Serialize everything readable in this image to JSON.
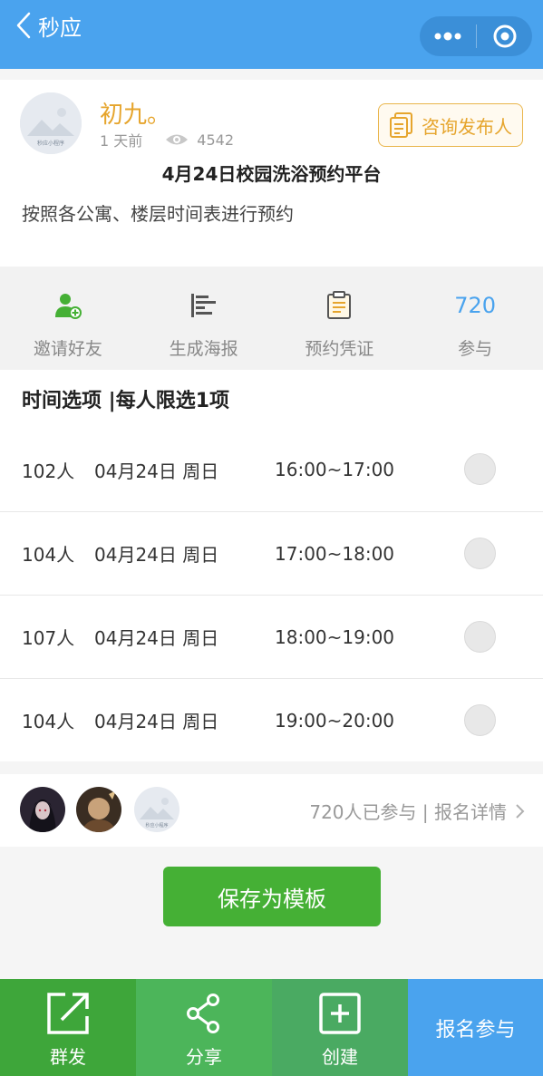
{
  "topbar": {
    "title": "秒应",
    "menu_icon": "more-dots-icon",
    "close_icon": "target-circle-icon"
  },
  "header": {
    "author": "初九。",
    "time_ago": "1 天前",
    "views": "4542",
    "consult_label": "咨询发布人",
    "avatar_watermark": "秒应小程序",
    "title": "4月24日校园洗浴预约平台",
    "description": "按照各公寓、楼层时间表进行预约"
  },
  "actions": [
    {
      "label": "邀请好友",
      "icon": "invite-friend-icon"
    },
    {
      "label": "生成海报",
      "icon": "poster-icon"
    },
    {
      "label": "预约凭证",
      "icon": "voucher-icon"
    },
    {
      "label": "参与",
      "value": "720"
    }
  ],
  "section": {
    "title": "时间选项 |每人限选1项"
  },
  "options": [
    {
      "count": "102人",
      "date": "04月24日 周日",
      "time": "16:00~17:00"
    },
    {
      "count": "104人",
      "date": "04月24日 周日",
      "time": "17:00~18:00"
    },
    {
      "count": "107人",
      "date": "04月24日 周日",
      "time": "18:00~19:00"
    },
    {
      "count": "104人",
      "date": "04月24日 周日",
      "time": "19:00~20:00"
    }
  ],
  "participants": {
    "summary": "720人已参与 | 报名详情",
    "avatar_watermark": "秒应小程序"
  },
  "save_button": "保存为模板",
  "bottom_bar": [
    {
      "label": "群发",
      "icon": "edit-share-icon"
    },
    {
      "label": "分享",
      "icon": "share-icon"
    },
    {
      "label": "创建",
      "icon": "plus-box-icon"
    },
    {
      "label": "报名参与"
    }
  ],
  "colors": {
    "topbar": "#4aa3ee",
    "accent_gold": "#e6a52d",
    "accent_blue": "#4aa3ee",
    "save_green": "#45b035"
  }
}
